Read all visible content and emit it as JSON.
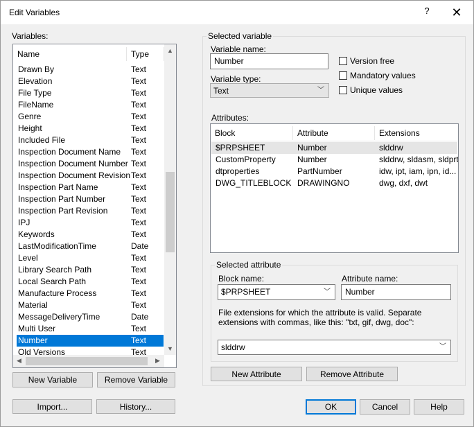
{
  "window": {
    "title": "Edit Variables",
    "help_glyph": "?",
    "close_glyph": "✕"
  },
  "variables": {
    "label": "Variables:",
    "columns": {
      "name": "Name",
      "type": "Type"
    },
    "rows": [
      {
        "name": "Drawn By",
        "type": "Text"
      },
      {
        "name": "Elevation",
        "type": "Text"
      },
      {
        "name": "File Type",
        "type": "Text"
      },
      {
        "name": "FileName",
        "type": "Text"
      },
      {
        "name": "Genre",
        "type": "Text"
      },
      {
        "name": "Height",
        "type": "Text"
      },
      {
        "name": "Included File",
        "type": "Text"
      },
      {
        "name": "Inspection Document Name",
        "type": "Text"
      },
      {
        "name": "Inspection Document Number",
        "type": "Text"
      },
      {
        "name": "Inspection Document Revision",
        "type": "Text"
      },
      {
        "name": "Inspection Part Name",
        "type": "Text"
      },
      {
        "name": "Inspection Part Number",
        "type": "Text"
      },
      {
        "name": "Inspection Part Revision",
        "type": "Text"
      },
      {
        "name": "IPJ",
        "type": "Text"
      },
      {
        "name": "Keywords",
        "type": "Text"
      },
      {
        "name": "LastModificationTime",
        "type": "Date"
      },
      {
        "name": "Level",
        "type": "Text"
      },
      {
        "name": "Library Search Path",
        "type": "Text"
      },
      {
        "name": "Local Search Path",
        "type": "Text"
      },
      {
        "name": "Manufacture Process",
        "type": "Text"
      },
      {
        "name": "Material",
        "type": "Text"
      },
      {
        "name": "MessageDeliveryTime",
        "type": "Date"
      },
      {
        "name": "Multi User",
        "type": "Text"
      },
      {
        "name": "Number",
        "type": "Text"
      },
      {
        "name": "Old Versions",
        "type": "Text"
      }
    ],
    "selected_index": 23,
    "new_button": "New Variable",
    "remove_button": "Remove Variable"
  },
  "selected_variable": {
    "group_label": "Selected variable",
    "name_label": "Variable name:",
    "name_value": "Number",
    "type_label": "Variable type:",
    "type_value": "Text",
    "checkboxes": {
      "version_free": "Version free",
      "mandatory": "Mandatory values",
      "unique": "Unique values"
    },
    "attributes_label": "Attributes:",
    "attr_columns": {
      "block": "Block",
      "attribute": "Attribute",
      "extensions": "Extensions"
    },
    "attr_rows": [
      {
        "block": "$PRPSHEET",
        "attribute": "Number",
        "extensions": "slddrw"
      },
      {
        "block": "CustomProperty",
        "attribute": "Number",
        "extensions": "slddrw, sldasm, sldprt"
      },
      {
        "block": "dtproperties",
        "attribute": "PartNumber",
        "extensions": "idw, ipt, iam, ipn, id..."
      },
      {
        "block": "DWG_TITLEBLOCK",
        "attribute": "DRAWINGNO",
        "extensions": "dwg, dxf, dwt"
      }
    ]
  },
  "selected_attribute": {
    "group_label": "Selected attribute",
    "block_label": "Block name:",
    "block_value": "$PRPSHEET",
    "attr_label": "Attribute name:",
    "attr_value": "Number",
    "ext_help": "File extensions for which the attribute is valid. Separate extensions with commas, like this: \"txt, gif, dwg, doc\":",
    "ext_value": "slddrw",
    "new_button": "New Attribute",
    "remove_button": "Remove Attribute"
  },
  "footer": {
    "import": "Import...",
    "history": "History...",
    "ok": "OK",
    "cancel": "Cancel",
    "help": "Help"
  }
}
